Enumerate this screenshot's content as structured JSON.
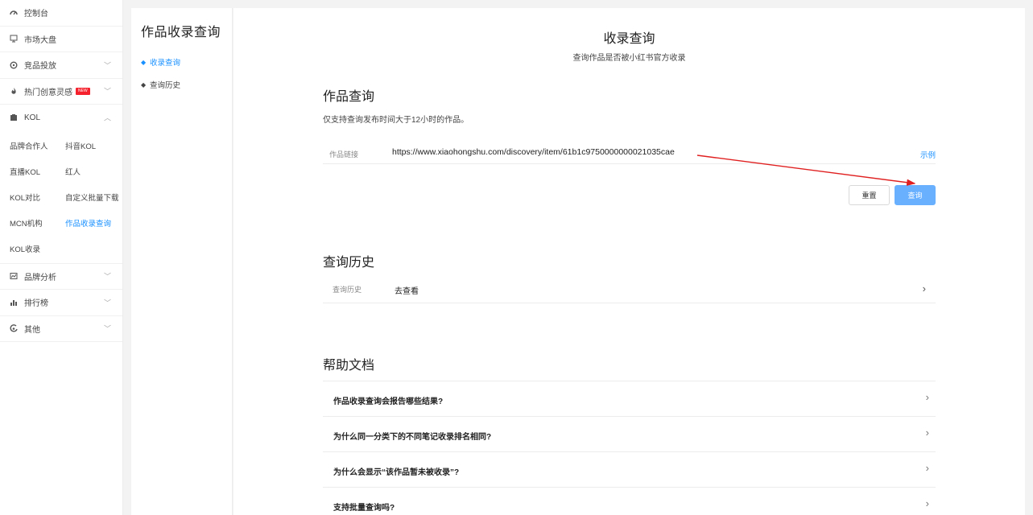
{
  "sidebar": {
    "items": [
      {
        "label": "控制台",
        "icon": "dashboard-icon"
      },
      {
        "label": "市场大盘",
        "icon": "market-icon"
      },
      {
        "label": "竞品投放",
        "icon": "target-icon"
      },
      {
        "label": "热门创意灵感",
        "icon": "fire-icon",
        "badge": "NEW"
      },
      {
        "label": "KOL",
        "icon": "kol-icon"
      }
    ],
    "kol_sub": [
      "品牌合作人",
      "抖音KOL",
      "直播KOL",
      "红人",
      "KOL对比",
      "自定义批量下载",
      "MCN机构",
      "作品收录查询",
      "KOL收录"
    ],
    "bottom_items": [
      {
        "label": "品牌分析",
        "icon": "chart-icon"
      },
      {
        "label": "排行榜",
        "icon": "bar-chart-icon"
      },
      {
        "label": "其他",
        "icon": "other-icon"
      }
    ]
  },
  "subpanel": {
    "title": "作品收录查询",
    "links": [
      "收录查询",
      "查询历史"
    ]
  },
  "main": {
    "title": "收录查询",
    "subtitle": "查询作品是否被小红书官方收录",
    "query_section": {
      "heading": "作品查询",
      "desc": "仅支持查询发布时间大于12小时的作品。",
      "field_label": "作品链接",
      "field_value": "https://www.xiaohongshu.com/discovery/item/61b1c9750000000021035cae",
      "example_label": "示例",
      "reset_label": "重置",
      "query_label": "查询"
    },
    "history_section": {
      "heading": "查询历史",
      "row_label": "查询历史",
      "row_value": "去查看"
    },
    "help_section": {
      "heading": "帮助文档",
      "faqs": [
        "作品收录查询会报告哪些结果?",
        "为什么同一分类下的不同笔记收录排名相同?",
        "为什么会显示“该作品暂未被收录”?",
        "支持批量查询吗?"
      ]
    }
  },
  "colors": {
    "accent": "#1890ff",
    "button_primary": "#69b1ff",
    "annotation_arrow": "#e02020"
  }
}
